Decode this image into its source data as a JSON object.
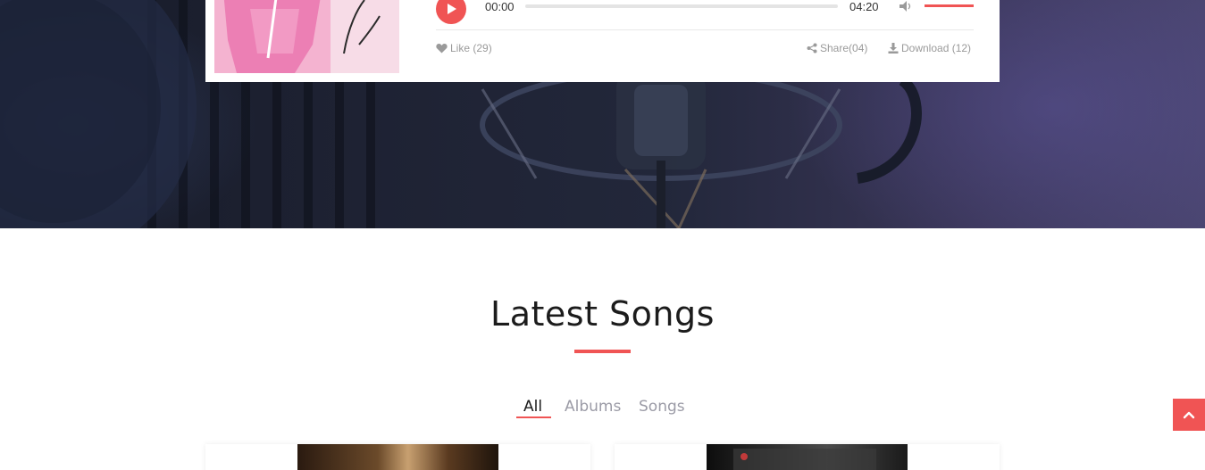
{
  "player": {
    "current_time": "00:00",
    "duration": "04:20",
    "progress": 0,
    "volume": 1.0,
    "cover_signature": "Leja",
    "like_label": "Like (29)",
    "share_label": "Share(04)",
    "download_label": "Download (12)"
  },
  "latest_songs": {
    "title": "Latest Songs",
    "tabs": [
      {
        "label": "All",
        "active": true
      },
      {
        "label": "Albums",
        "active": false
      },
      {
        "label": "Songs",
        "active": false
      }
    ]
  },
  "colors": {
    "accent": "#f05454",
    "text_dark": "#1c1c1c",
    "text_muted": "#9b9ba6"
  },
  "icons": [
    "play-icon",
    "volume-icon",
    "heart-icon",
    "share-icon",
    "download-icon",
    "chevron-up-icon"
  ]
}
